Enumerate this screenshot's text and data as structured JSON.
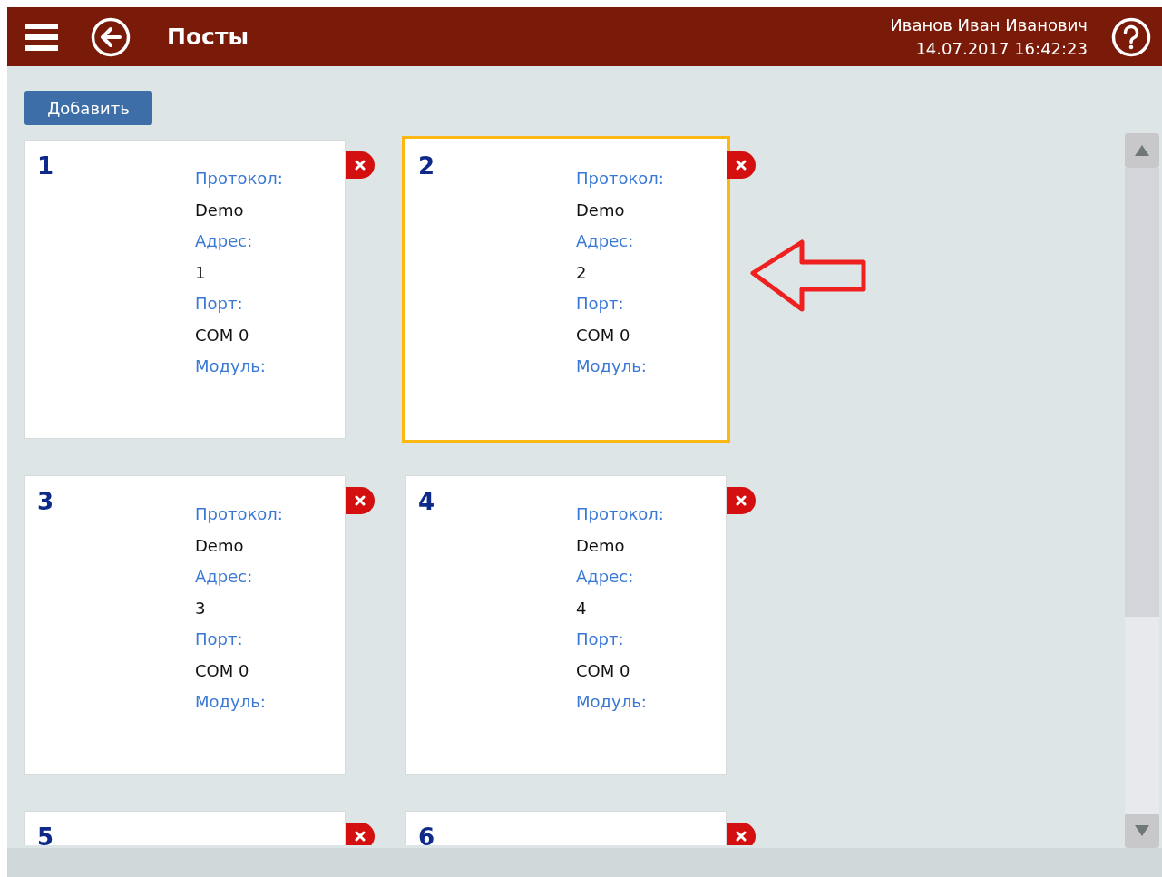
{
  "header": {
    "title": "Посты",
    "user": "Иванов Иван Иванович",
    "datetime": "14.07.2017 16:42:23"
  },
  "add_button": "Добавить",
  "cards": [
    {
      "number": "1",
      "selected": false,
      "fields": [
        {
          "label": "Протокол:",
          "value": "Demo"
        },
        {
          "label": "Адрес:",
          "value": "1"
        },
        {
          "label": "Порт:",
          "value": "COM 0"
        },
        {
          "label": "Модуль:"
        }
      ]
    },
    {
      "number": "2",
      "selected": true,
      "fields": [
        {
          "label": "Протокол:",
          "value": "Demo"
        },
        {
          "label": "Адрес:",
          "value": "2"
        },
        {
          "label": "Порт:",
          "value": "COM 0"
        },
        {
          "label": "Модуль:"
        }
      ]
    },
    {
      "number": "3",
      "selected": false,
      "fields": [
        {
          "label": "Протокол:",
          "value": "Demo"
        },
        {
          "label": "Адрес:",
          "value": "3"
        },
        {
          "label": "Порт:",
          "value": "COM 0"
        },
        {
          "label": "Модуль:"
        }
      ]
    },
    {
      "number": "4",
      "selected": false,
      "fields": [
        {
          "label": "Протокол:",
          "value": "Demo"
        },
        {
          "label": "Адрес:",
          "value": "4"
        },
        {
          "label": "Порт:",
          "value": "COM 0"
        },
        {
          "label": "Модуль:"
        }
      ]
    },
    {
      "number": "5",
      "selected": false
    },
    {
      "number": "6",
      "selected": false
    }
  ]
}
